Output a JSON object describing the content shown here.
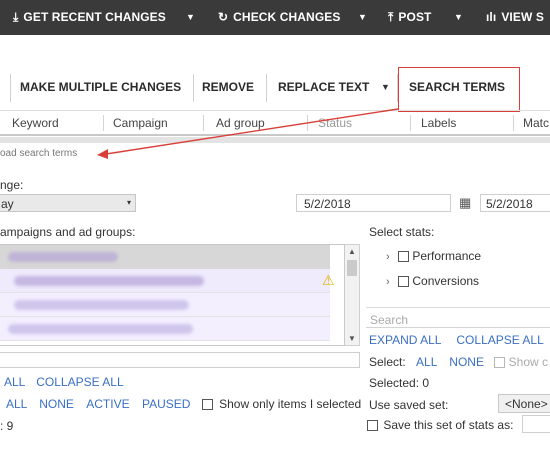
{
  "toolbar": {
    "get_recent": "GET RECENT CHANGES",
    "check_changes": "CHECK CHANGES",
    "post": "POST",
    "view": "VIEW S"
  },
  "actions": {
    "make_multiple": "MAKE MULTIPLE CHANGES",
    "remove": "REMOVE",
    "replace_text": "REPLACE TEXT",
    "search_terms": "SEARCH TERMS"
  },
  "columns": [
    "Keyword",
    "Campaign",
    "Ad group",
    "Status",
    "Labels",
    "Matc"
  ],
  "annotation": {
    "color": "#d9403a"
  },
  "panel": {
    "download_label": "oad search terms",
    "date_range_label": "nge:",
    "date_range_value": "ay",
    "start_date": "5/2/2018",
    "end_date": "5/2/2018",
    "campaigns_label": "ampaigns and ad groups:",
    "footer_links": {
      "all": "ALL",
      "collapse_all": "COLLAPSE ALL"
    },
    "select_all": "ALL",
    "select_none": "NONE",
    "select_active": "ACTIVE",
    "select_paused": "PAUSED",
    "show_only_selected": "Show only items I selected",
    "count_text": ": 9"
  },
  "stats": {
    "label": "Select stats:",
    "items": [
      "Performance",
      "Conversions"
    ],
    "search_placeholder": "Search",
    "expand_all": "EXPAND ALL",
    "collapse_all": "COLLAPSE ALL",
    "select_label": "Select:",
    "select_all": "ALL",
    "select_none": "NONE",
    "show_label": "Show c",
    "selected_count": "Selected: 0",
    "use_saved_set": "Use saved set:",
    "saved_set_value": "<None>",
    "save_set_label": "Save this set of stats as:"
  }
}
